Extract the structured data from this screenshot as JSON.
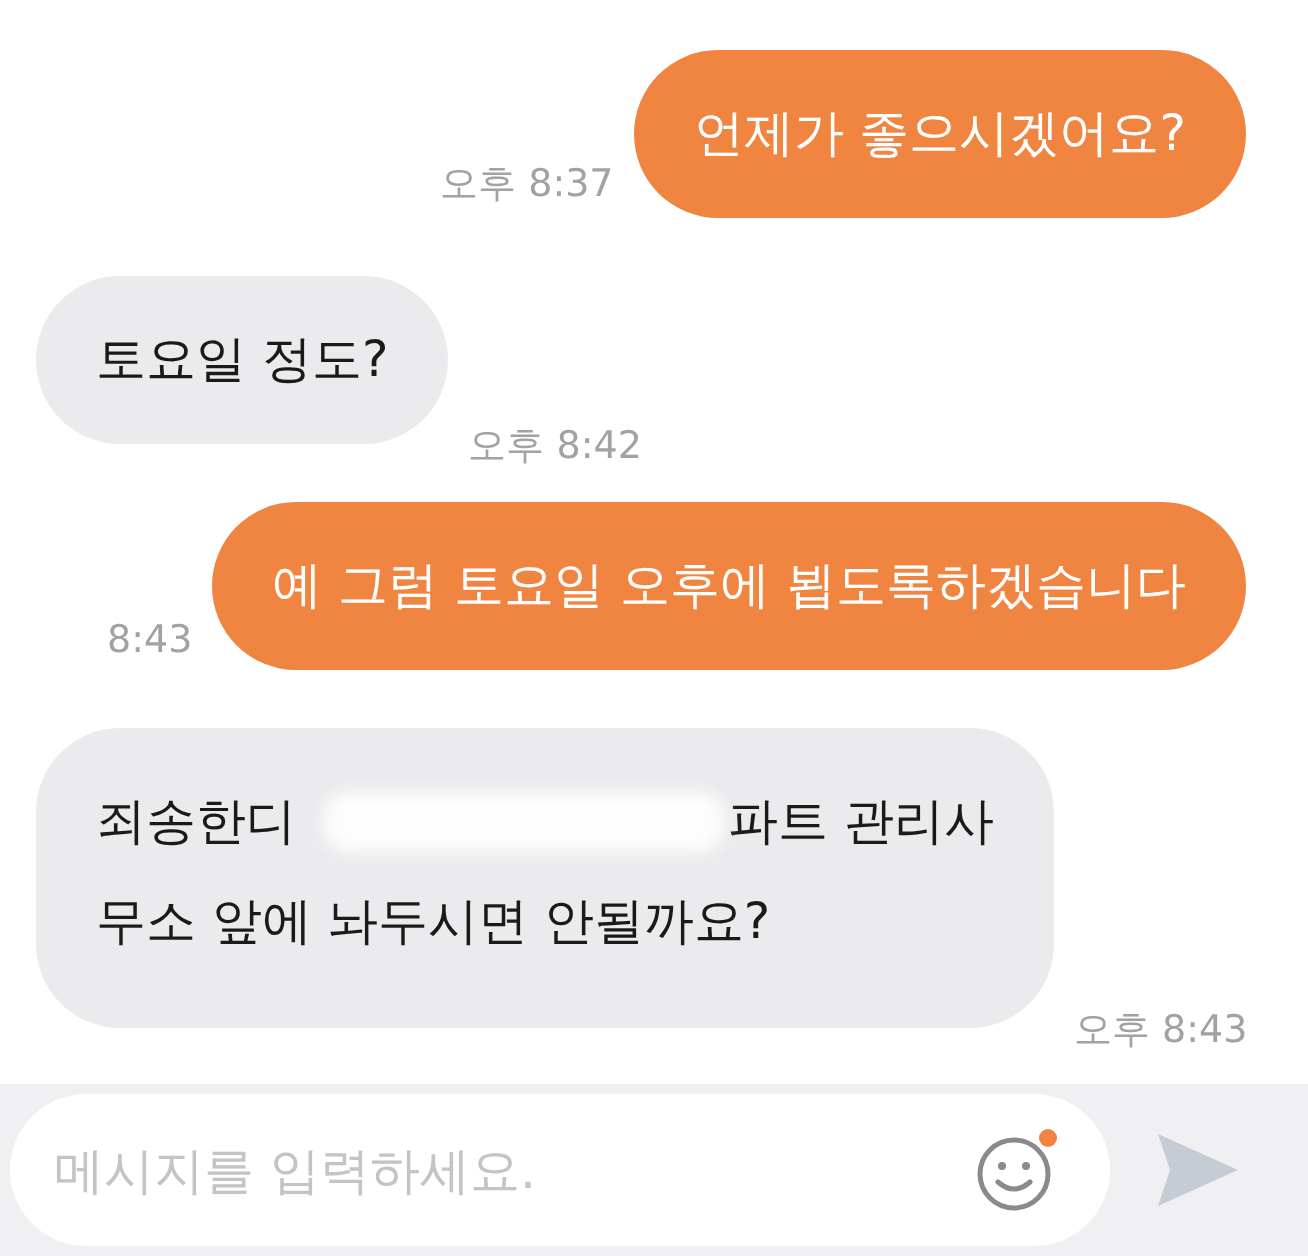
{
  "messages": [
    {
      "kind": "outgoing",
      "lines": [
        [
          {
            "kind": "text",
            "text": "언제가 좋으시겠어요?"
          }
        ]
      ],
      "time": "오후 8:37"
    },
    {
      "kind": "incoming",
      "lines": [
        [
          {
            "kind": "text",
            "text": "토요일 정도?"
          }
        ]
      ],
      "time": "오후 8:42"
    },
    {
      "kind": "outgoing",
      "lines": [
        [
          {
            "kind": "text",
            "text": "예 그럼 토요일 오후에 뵙도록하겠습니다"
          }
        ]
      ],
      "time": "8:43"
    },
    {
      "kind": "incoming",
      "lines": [
        [
          {
            "kind": "text",
            "text": "죄송한디"
          },
          {
            "kind": "redacted"
          },
          {
            "kind": "text",
            "text": "파트 관리사"
          }
        ],
        [
          {
            "kind": "text",
            "text": "무소 앞에 놔두시면 안될까요?"
          }
        ]
      ],
      "time": "오후 8:43"
    }
  ],
  "composer": {
    "placeholder": "메시지를 입력하세요.",
    "emoji_badge": true
  }
}
